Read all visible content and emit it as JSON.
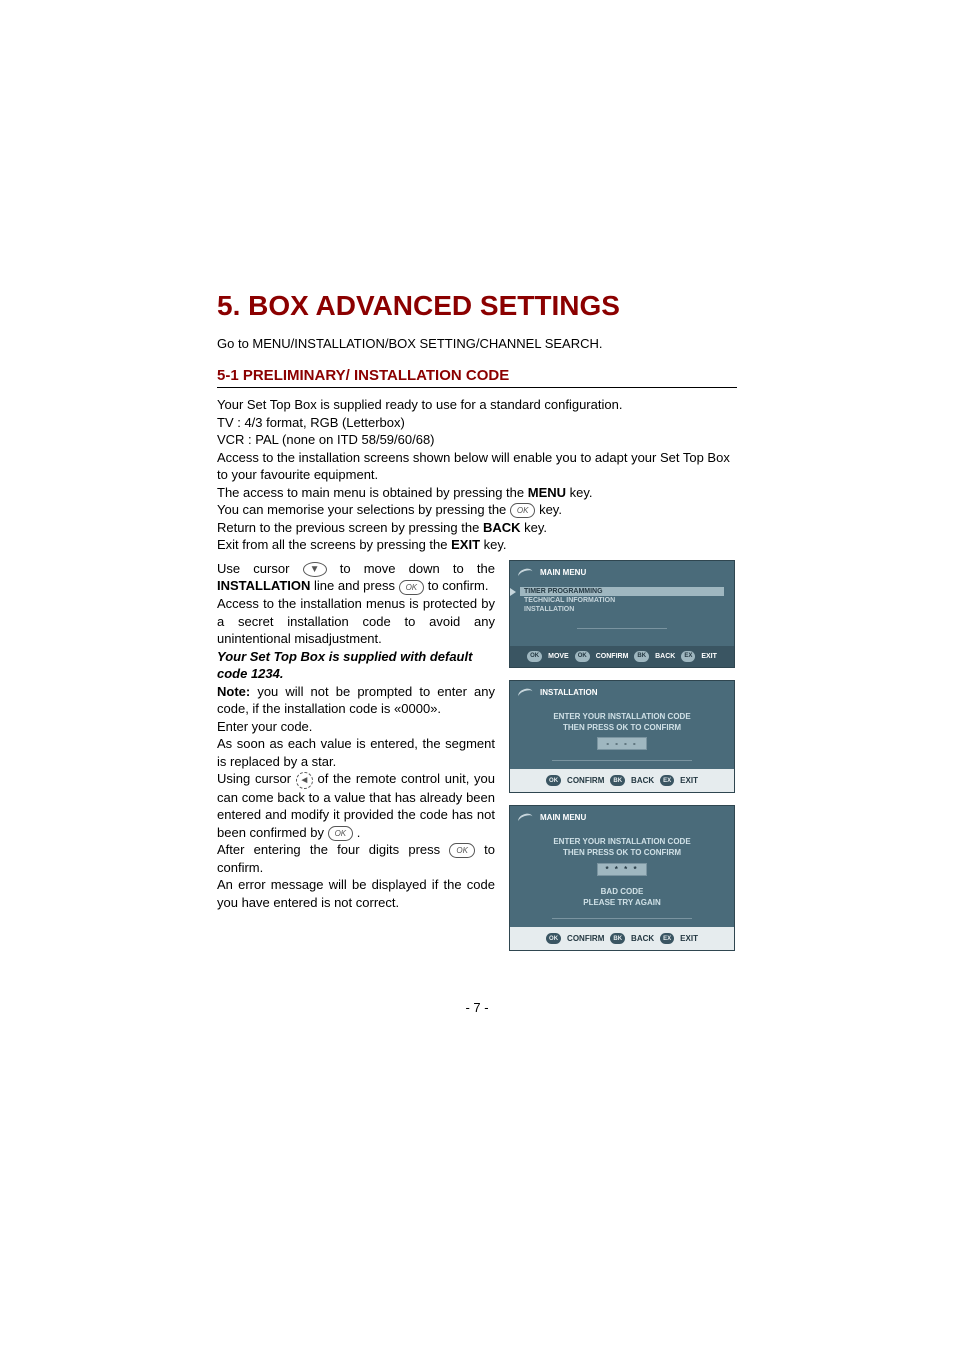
{
  "title": "5. BOX ADVANCED SETTINGS",
  "nav": "Go to MENU/INSTALLATION/BOX SETTING/CHANNEL SEARCH.",
  "section": "5-1 PRELIMINARY/ INSTALLATION CODE",
  "p1": "Your Set Top Box is supplied ready to use for a standard configuration.",
  "p2": "TV : 4/3 format, RGB (Letterbox)",
  "p3": "VCR : PAL (none on ITD 58/59/60/68)",
  "p4": "Access to the installation screens shown below will enable you to adapt your Set Top Box to your favourite equipment.",
  "p5a": "The access to main menu is obtained by pressing the ",
  "p5b": "MENU",
  "p5c": " key.",
  "p6a": "You can memorise your selections by pressing the ",
  "p6b": " key.",
  "p7a": "Return to the previous screen by pressing the ",
  "p7b": "BACK",
  "p7c": " key.",
  "p8a": "Exit from all the screens by pressing the ",
  "p8b": "EXIT",
  "p8c": " key.",
  "p9a": "Use cursor ",
  "p9b": " to move down to the ",
  "p9c": "INSTALLATION",
  "p9d": " line and press ",
  "p9e": " to confirm.",
  "p10": "Access to the installation menus is protected by a secret installation code to avoid any unintentional misadjustment.",
  "p11": "Your Set Top Box is supplied with default code 1234.",
  "p12a": "Note:",
  "p12b": " you will not be prompted to enter any code, if the installation code is «0000».",
  "p13": "Enter your code.",
  "p14": "As soon as each value is entered, the segment is replaced by a star.",
  "p15a": "Using cursor ",
  "p15b": " of the remote control unit, you can come back to a value that has already been entered and modify it provided the code has not been confirmed by ",
  "p15c": " .",
  "p16a": "After entering the four digits press ",
  "p16b": " to confirm.",
  "p17": "An error message will be displayed if the code you have entered is not correct.",
  "okLabel": "OK",
  "arrowDown": "▼",
  "arrowLeft": "◄",
  "page": "- 7 -",
  "screen1": {
    "title": "MAIN MENU",
    "items": [
      "TIMER PROGRAMMING",
      "TECHNICAL INFORMATION",
      "INSTALLATION"
    ],
    "footer": {
      "move": "MOVE",
      "confirm": "CONFIRM",
      "back": "BACK",
      "exit": "EXIT"
    }
  },
  "screen2": {
    "title": "INSTALLATION",
    "line1": "ENTER YOUR INSTALLATION CODE",
    "line2": "THEN PRESS OK TO CONFIRM",
    "code": "- - - -",
    "footer": {
      "confirm": "CONFIRM",
      "back": "BACK",
      "exit": "EXIT"
    }
  },
  "screen3": {
    "title": "MAIN MENU",
    "line1": "ENTER YOUR INSTALLATION CODE",
    "line2": "THEN PRESS OK TO CONFIRM",
    "code": "* * * *",
    "err1": "BAD CODE",
    "err2": "PLEASE TRY AGAIN",
    "footer": {
      "confirm": "CONFIRM",
      "back": "BACK",
      "exit": "EXIT"
    }
  },
  "pill": {
    "ok": "OK",
    "bk": "BK",
    "ex": "EX"
  }
}
